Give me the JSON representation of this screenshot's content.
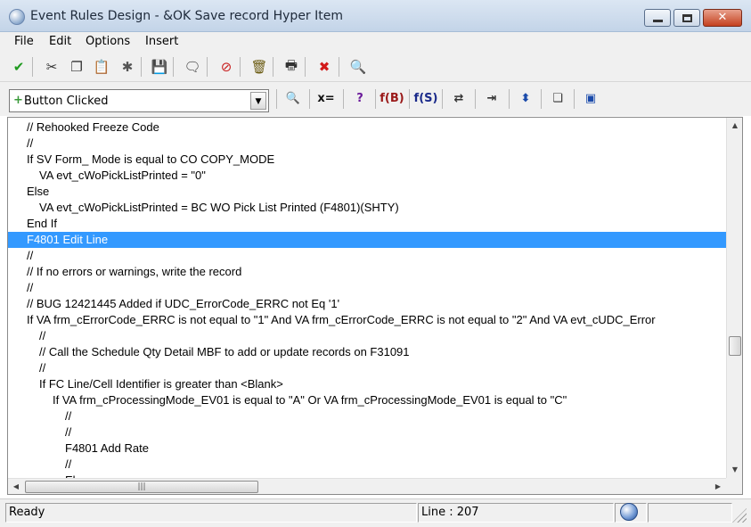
{
  "window": {
    "title": "Event Rules Design - &OK Save record Hyper Item",
    "minimize_glyph": "",
    "close_glyph": "✕"
  },
  "menu": {
    "items": [
      "File",
      "Edit",
      "Options",
      "Insert"
    ]
  },
  "toolbar1": {
    "icons": [
      {
        "name": "ok-check-icon",
        "glyph": "✔",
        "color": "#1f9a1f"
      },
      {
        "name": "cut-icon",
        "glyph": "✂",
        "color": "#333"
      },
      {
        "name": "copy-icon",
        "glyph": "❐",
        "color": "#333"
      },
      {
        "name": "paste-icon",
        "glyph": "📋",
        "color": "#8a6a1a"
      },
      {
        "name": "paste-special-icon",
        "glyph": "✱",
        "color": "#555"
      },
      {
        "name": "save-icon",
        "glyph": "💾",
        "color": "#1a3a9a"
      },
      {
        "name": "comment-icon",
        "glyph": "🗨",
        "color": "#333"
      },
      {
        "name": "disable-icon",
        "glyph": "⊘",
        "color": "#c81e1e"
      },
      {
        "name": "delete-icon",
        "glyph": "🗑",
        "color": "#6a5a10"
      },
      {
        "name": "print-icon",
        "glyph": "🖶",
        "color": "#333"
      },
      {
        "name": "cancel-icon",
        "glyph": "✖",
        "color": "#d21a1a"
      },
      {
        "name": "find-icon",
        "glyph": "🔍",
        "color": "#333"
      }
    ]
  },
  "event_selector": {
    "selected": "Button Clicked",
    "icon": "+",
    "arrow": "▼"
  },
  "toolbar2": {
    "icons": [
      {
        "name": "search-variable-icon",
        "glyph": "🔍",
        "color": "#333"
      },
      {
        "name": "assignment-icon",
        "glyph": "x=",
        "color": "#111"
      },
      {
        "name": "if-question-icon",
        "glyph": "?",
        "color": "#6a1a9a"
      },
      {
        "name": "business-function-icon",
        "glyph": "f(B)",
        "color": "#9a1a1a"
      },
      {
        "name": "system-function-icon",
        "glyph": "f(S)",
        "color": "#1a2a8a"
      },
      {
        "name": "table-io-icon",
        "glyph": "⇄",
        "color": "#333"
      },
      {
        "name": "insert-line-icon",
        "glyph": "⇥",
        "color": "#333"
      },
      {
        "name": "while-loop-icon",
        "glyph": "⬍",
        "color": "#1a4aaa"
      },
      {
        "name": "report-interconnect-icon",
        "glyph": "❏",
        "color": "#333"
      },
      {
        "name": "form-interconnect-icon",
        "glyph": "▣",
        "color": "#1a4aaa"
      }
    ]
  },
  "code": {
    "selected_index": 7,
    "lines": [
      {
        "indent": 0,
        "text": "// Rehooked Freeze Code"
      },
      {
        "indent": 0,
        "text": "//"
      },
      {
        "indent": 0,
        "text": "If SV Form_ Mode is equal to CO COPY_MODE"
      },
      {
        "indent": 1,
        "text": "VA evt_cWoPickListPrinted = \"0\""
      },
      {
        "indent": 0,
        "text": "Else"
      },
      {
        "indent": 1,
        "text": "VA evt_cWoPickListPrinted = BC WO Pick List Printed (F4801)(SHTY)"
      },
      {
        "indent": 0,
        "text": "End If"
      },
      {
        "indent": 0,
        "text": "F4801 Edit Line"
      },
      {
        "indent": 0,
        "text": "//"
      },
      {
        "indent": 0,
        "text": "//       If no errors or warnings, write the record"
      },
      {
        "indent": 0,
        "text": "//"
      },
      {
        "indent": 0,
        "text": "// BUG 12421445 Added if UDC_ErrorCode_ERRC not Eq '1'"
      },
      {
        "indent": 0,
        "text": "If VA frm_cErrorCode_ERRC is not equal to \"1\" And VA frm_cErrorCode_ERRC is not equal to \"2\" And VA evt_cUDC_Error"
      },
      {
        "indent": 1,
        "text": "//"
      },
      {
        "indent": 1,
        "text": "//       Call the Schedule Qty Detail MBF to add or update records on F31091"
      },
      {
        "indent": 1,
        "text": "//"
      },
      {
        "indent": 1,
        "text": "If FC Line/Cell Identifier is greater than <Blank>"
      },
      {
        "indent": 2,
        "text": "If VA frm_cProcessingMode_EV01 is equal to \"A\" Or VA frm_cProcessingMode_EV01 is equal to \"C\""
      },
      {
        "indent": 3,
        "text": "//"
      },
      {
        "indent": 3,
        "text": "//"
      },
      {
        "indent": 3,
        "text": "F4801 Add Rate"
      },
      {
        "indent": 3,
        "text": "//"
      },
      {
        "indent": 3,
        "text": "El"
      }
    ]
  },
  "scrollbars": {
    "up": "▲",
    "down": "▼",
    "left": "◀",
    "right": "▶",
    "grip": "|||"
  },
  "status": {
    "state": "Ready",
    "line": "Line : 207"
  }
}
